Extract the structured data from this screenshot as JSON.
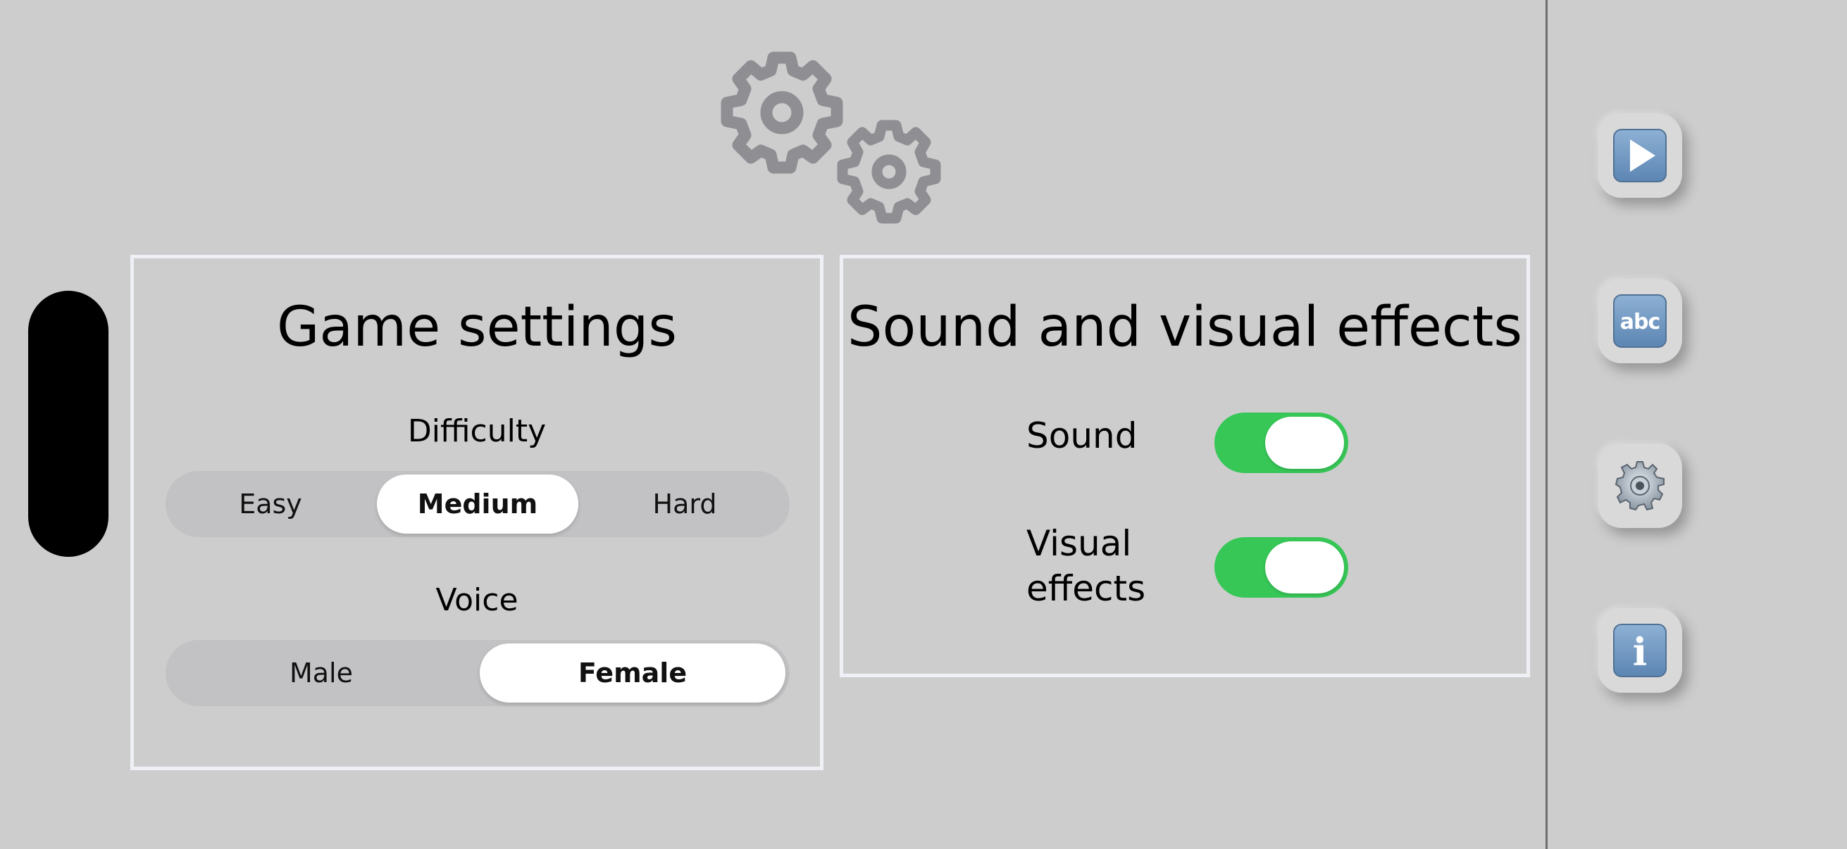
{
  "game_settings": {
    "title": "Game settings",
    "difficulty_label": "Difficulty",
    "difficulty_options": [
      "Easy",
      "Medium",
      "Hard"
    ],
    "difficulty_selected": "Medium",
    "voice_label": "Voice",
    "voice_options": [
      "Male",
      "Female"
    ],
    "voice_selected": "Female"
  },
  "effects": {
    "title": "Sound and visual effects",
    "sound_label": "Sound",
    "sound_on": true,
    "visual_label": "Visual effects",
    "visual_on": true
  },
  "rail": {
    "play_icon": "play-icon",
    "text_icon_text": "abc",
    "settings_icon": "gear-icon",
    "info_icon_text": "i"
  },
  "colors": {
    "background": "#cdcdcd",
    "toggle_on": "#37c757",
    "tile_blue": "#6b93bf",
    "gear_gray": "#8e8e93"
  }
}
